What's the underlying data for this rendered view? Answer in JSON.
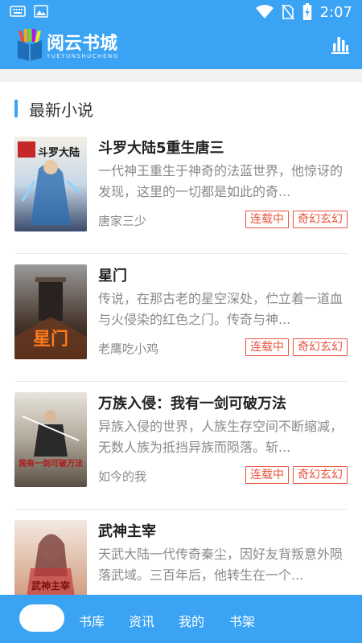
{
  "status_bar": {
    "time": "2:07"
  },
  "header": {
    "title": "阅云书城",
    "subtitle": "YUEYUNSHUCHENG"
  },
  "section": {
    "title": "最新小说"
  },
  "books": [
    {
      "title": "斗罗大陆5重生唐三",
      "description": "一代神王重生于神奇的法蓝世界，他惊讶的发现，这里的一切都是如此的奇...",
      "author": "唐家三少",
      "status": "连载中",
      "genre": "奇幻玄幻",
      "cover_text": "斗罗大陆"
    },
    {
      "title": "星门",
      "description": "传说，在那古老的星空深处，伫立着一道血与火侵染的红色之门。传奇与神...",
      "author": "老鹰吃小鸡",
      "status": "连载中",
      "genre": "奇幻玄幻",
      "cover_text": "星门"
    },
    {
      "title": "万族入侵：我有一剑可破万法",
      "description": "异族入侵的世界，人族生存空间不断缩减，无数人族为抵挡异族而陨落。斩...",
      "author": "如今的我",
      "status": "连载中",
      "genre": "奇幻玄幻",
      "cover_text": "我有一剑可破万法"
    },
    {
      "title": "武神主宰",
      "description": "天武大陆一代传奇秦尘，因好友背叛意外陨落武域。三百年后，他转生在一个...",
      "author": "",
      "status": "",
      "genre": "",
      "cover_text": "武神主宰"
    }
  ],
  "bottom_nav": {
    "items": [
      "书库",
      "资讯",
      "我的",
      "书架"
    ]
  },
  "colors": {
    "primary": "#3aa3f3",
    "tag_red": "#e9533e"
  }
}
